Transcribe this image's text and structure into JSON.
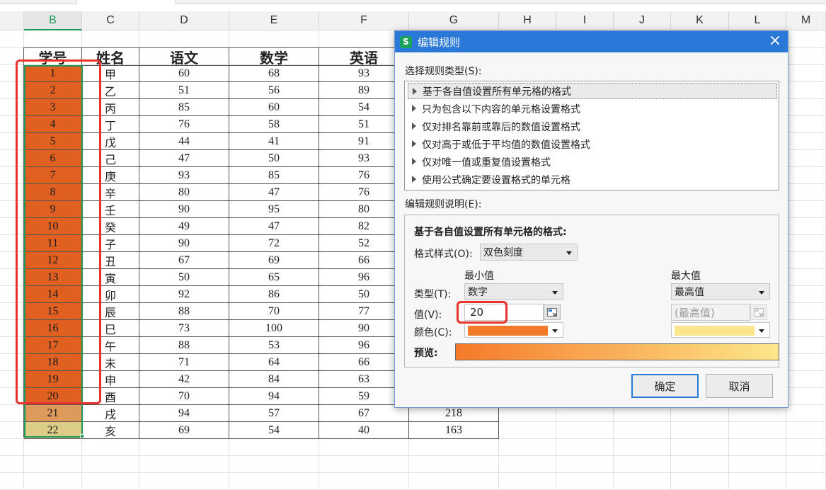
{
  "sheet": {
    "col_headers": [
      "B",
      "C",
      "D",
      "E",
      "F",
      "G",
      "H",
      "I",
      "J",
      "K",
      "L",
      "M"
    ],
    "table_headers": [
      "学号",
      "姓名",
      "语文",
      "数学",
      "英语"
    ],
    "rows": [
      {
        "id": "1",
        "name": "甲",
        "chinese": "60",
        "math": "68",
        "english": "93",
        "total": ""
      },
      {
        "id": "2",
        "name": "乙",
        "chinese": "51",
        "math": "56",
        "english": "89",
        "total": ""
      },
      {
        "id": "3",
        "name": "丙",
        "chinese": "85",
        "math": "60",
        "english": "54",
        "total": ""
      },
      {
        "id": "4",
        "name": "丁",
        "chinese": "76",
        "math": "58",
        "english": "51",
        "total": ""
      },
      {
        "id": "5",
        "name": "戊",
        "chinese": "44",
        "math": "41",
        "english": "91",
        "total": ""
      },
      {
        "id": "6",
        "name": "己",
        "chinese": "47",
        "math": "50",
        "english": "93",
        "total": ""
      },
      {
        "id": "7",
        "name": "庚",
        "chinese": "93",
        "math": "85",
        "english": "76",
        "total": ""
      },
      {
        "id": "8",
        "name": "辛",
        "chinese": "80",
        "math": "47",
        "english": "76",
        "total": ""
      },
      {
        "id": "9",
        "name": "壬",
        "chinese": "90",
        "math": "95",
        "english": "80",
        "total": ""
      },
      {
        "id": "10",
        "name": "癸",
        "chinese": "49",
        "math": "47",
        "english": "82",
        "total": ""
      },
      {
        "id": "11",
        "name": "子",
        "chinese": "90",
        "math": "72",
        "english": "52",
        "total": ""
      },
      {
        "id": "12",
        "name": "丑",
        "chinese": "67",
        "math": "69",
        "english": "66",
        "total": ""
      },
      {
        "id": "13",
        "name": "寅",
        "chinese": "50",
        "math": "65",
        "english": "96",
        "total": ""
      },
      {
        "id": "14",
        "name": "卯",
        "chinese": "92",
        "math": "86",
        "english": "50",
        "total": ""
      },
      {
        "id": "15",
        "name": "辰",
        "chinese": "88",
        "math": "70",
        "english": "77",
        "total": ""
      },
      {
        "id": "16",
        "name": "巳",
        "chinese": "73",
        "math": "100",
        "english": "90",
        "total": ""
      },
      {
        "id": "17",
        "name": "午",
        "chinese": "88",
        "math": "53",
        "english": "96",
        "total": ""
      },
      {
        "id": "18",
        "name": "未",
        "chinese": "71",
        "math": "64",
        "english": "66",
        "total": ""
      },
      {
        "id": "19",
        "name": "申",
        "chinese": "42",
        "math": "84",
        "english": "63",
        "total": ""
      },
      {
        "id": "20",
        "name": "酉",
        "chinese": "70",
        "math": "94",
        "english": "59",
        "total": ""
      },
      {
        "id": "21",
        "name": "戌",
        "chinese": "94",
        "math": "57",
        "english": "67",
        "total": "218"
      },
      {
        "id": "22",
        "name": "亥",
        "chinese": "69",
        "math": "54",
        "english": "40",
        "total": "163"
      }
    ],
    "fill_colors": {
      "orange": "#e06022",
      "row21": "#dd9a5a",
      "row22": "#dccc86",
      "selection": "#1e9b5a",
      "highlight": "#e8322b"
    }
  },
  "dialog": {
    "title": "编辑规则",
    "app_icon": "S",
    "close_icon": "×",
    "select_type_label": "选择规则类型(S):",
    "rule_types": [
      "基于各自值设置所有单元格的格式",
      "只为包含以下内容的单元格设置格式",
      "仅对排名靠前或靠后的数值设置格式",
      "仅对高于或低于平均值的数值设置格式",
      "仅对唯一值或重复值设置格式",
      "使用公式确定要设置格式的单元格"
    ],
    "edit_desc_label": "编辑规则说明(E):",
    "section_heading": "基于各自值设置所有单元格的格式:",
    "format_style_label": "格式样式(O):",
    "format_style_value": "双色刻度",
    "min_label": "最小值",
    "max_label": "最大值",
    "type_label": "类型(T):",
    "min_type": "数字",
    "max_type": "最高值",
    "value_label": "值(V):",
    "min_value": "20",
    "max_value_placeholder": "(最高值)",
    "color_label": "颜色(C):",
    "min_color": "#f47a2a",
    "max_color": "#fde68a",
    "preview_label": "预览:",
    "ok_label": "确定",
    "cancel_label": "取消",
    "titlebar_color": "#2a79d8"
  }
}
